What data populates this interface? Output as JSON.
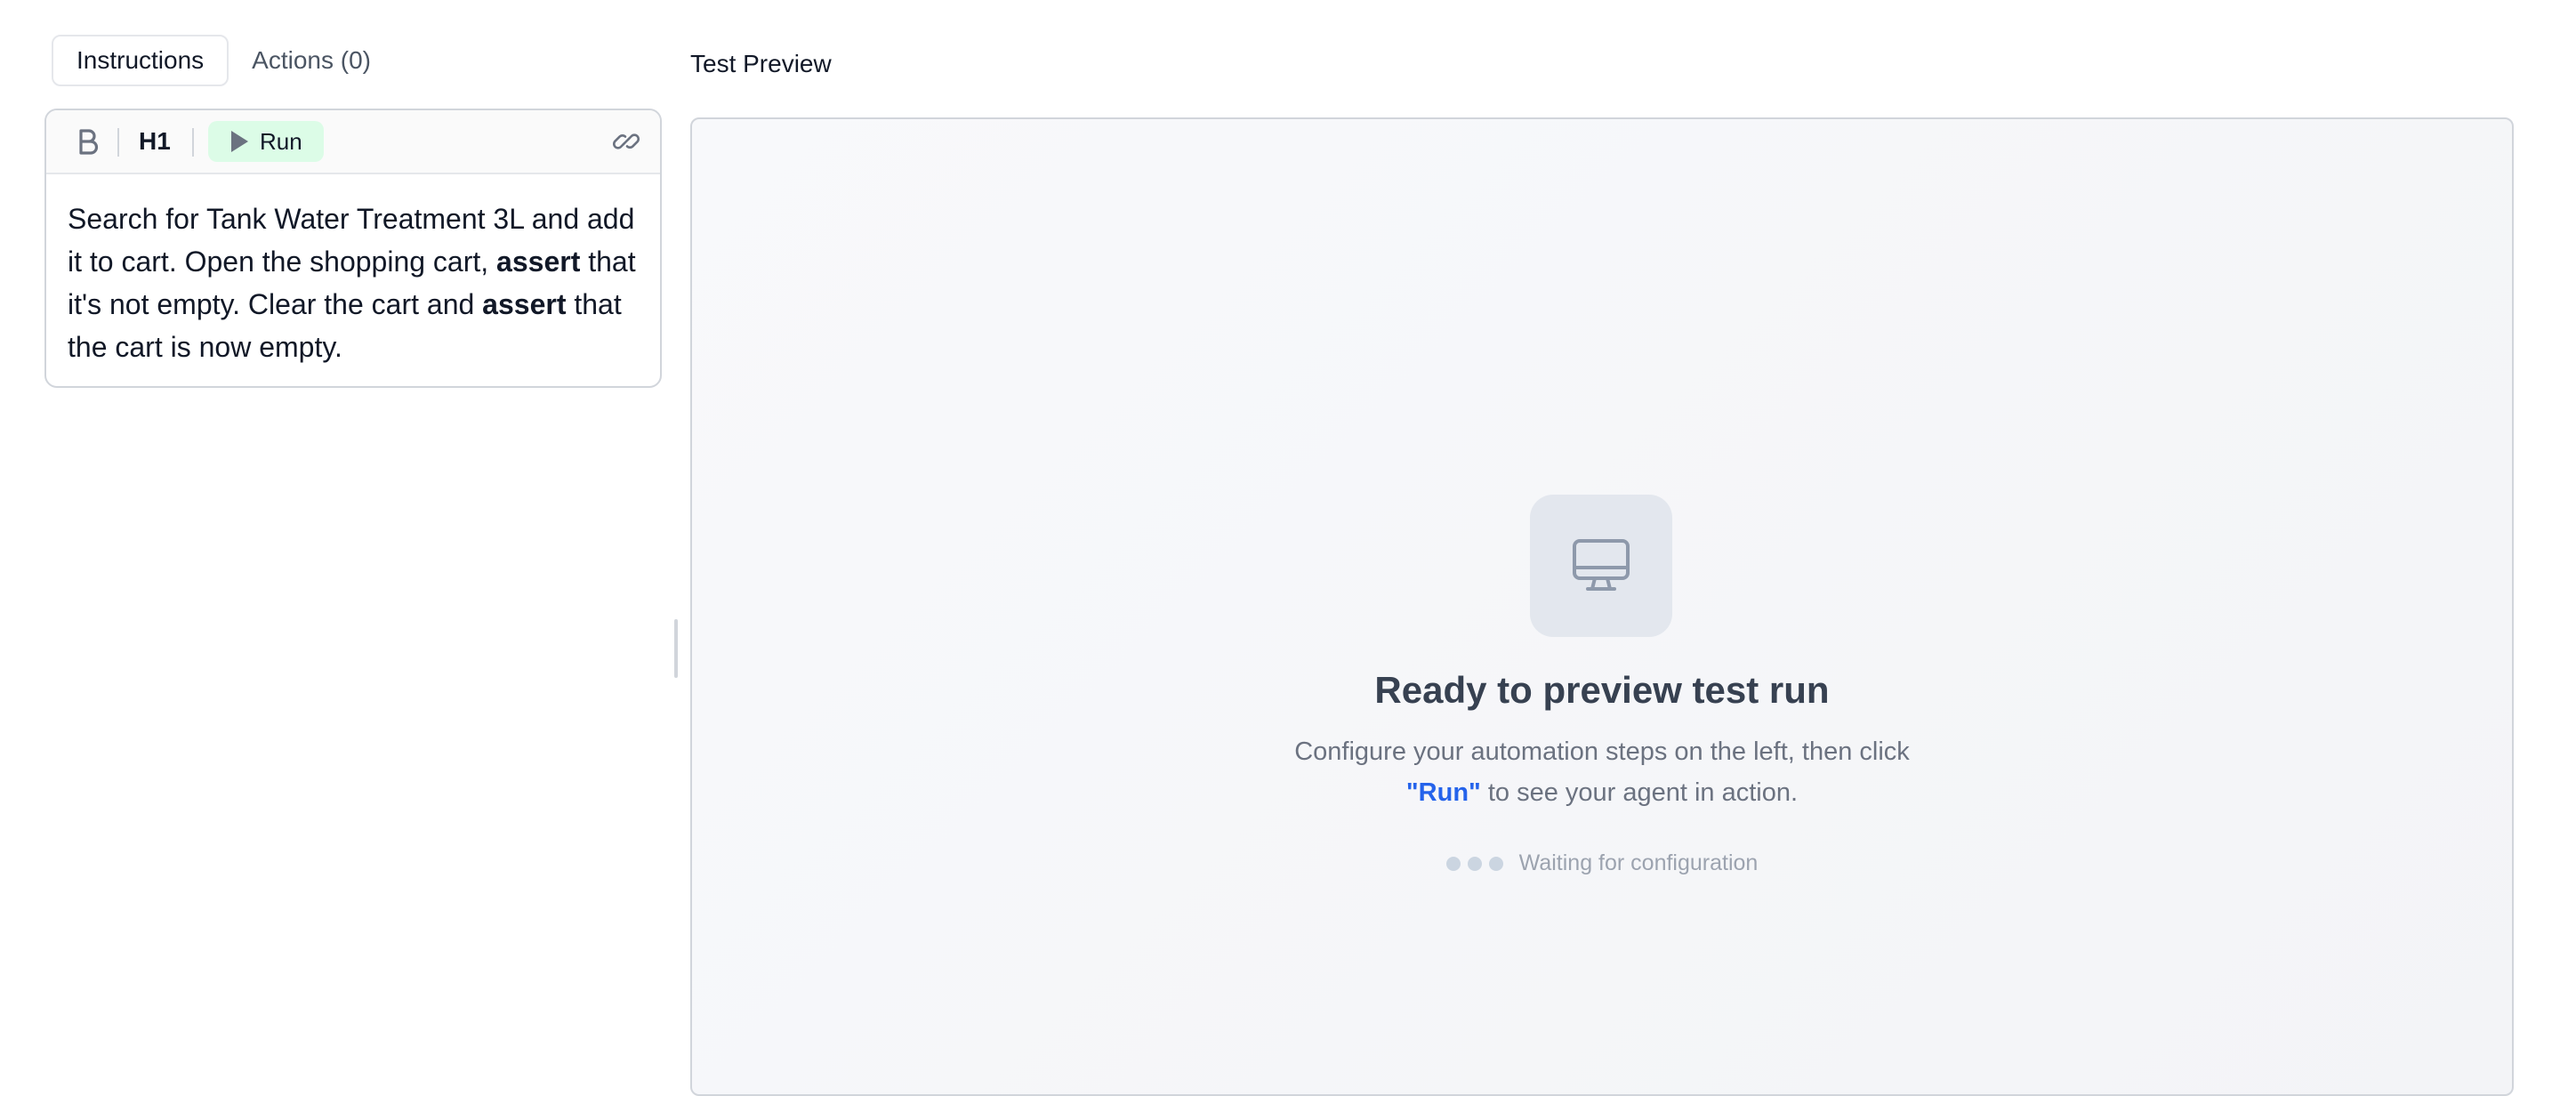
{
  "tabs": [
    {
      "label": "Instructions",
      "active": true
    },
    {
      "label": "Actions (0)",
      "active": false
    }
  ],
  "toolbar": {
    "bold_icon": "bold-icon",
    "heading_label": "H1",
    "run_label": "Run",
    "run_icon": "play-icon",
    "link_icon": "link-icon"
  },
  "editor": {
    "segments": [
      {
        "text": "Search for Tank Water Treatment 3L and add it to cart. Open the shopping cart, ",
        "bold": false
      },
      {
        "text": "assert",
        "bold": true
      },
      {
        "text": " that it's not empty. Clear the cart and ",
        "bold": false
      },
      {
        "text": "assert",
        "bold": true
      },
      {
        "text": " that the cart is now empty.",
        "bold": false
      }
    ]
  },
  "preview": {
    "label": "Test Preview",
    "icon": "monitor-icon",
    "title": "Ready to preview test run",
    "desc_line1": "Configure your automation steps on the left, then click",
    "desc_run": "\"Run\"",
    "desc_line2_rest": " to see your agent in action.",
    "waiting_text": "Waiting for configuration"
  },
  "colors": {
    "accent": "#2563eb",
    "run_bg": "#dcfce7",
    "preview_bg": "#f5f6f9",
    "title": "#374151"
  }
}
